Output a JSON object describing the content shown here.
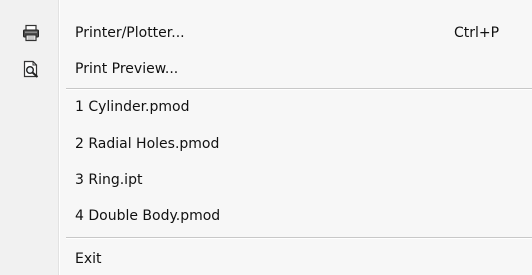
{
  "menu": {
    "items": [
      {
        "label": "Printer/Plotter...",
        "shortcut": "Ctrl+P",
        "icon": "printer-icon"
      },
      {
        "label": "Print Preview...",
        "shortcut": "",
        "icon": "print-preview-icon"
      }
    ],
    "recent_files": [
      {
        "label": "1 Cylinder.pmod"
      },
      {
        "label": "2 Radial Holes.pmod"
      },
      {
        "label": "3 Ring.ipt"
      },
      {
        "label": "4 Double Body.pmod"
      }
    ],
    "exit": {
      "label": "Exit"
    }
  }
}
